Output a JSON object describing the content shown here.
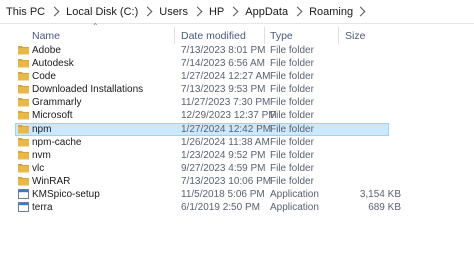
{
  "breadcrumb": {
    "items": [
      "This PC",
      "Local Disk (C:)",
      "Users",
      "HP",
      "AppData",
      "Roaming"
    ]
  },
  "columns": {
    "name": "Name",
    "date_modified": "Date modified",
    "type": "Type",
    "size": "Size"
  },
  "colors": {
    "folder": "#e8b84a",
    "folder_tab": "#d9a43a",
    "selection": "#cce8ff",
    "selection_border": "#99d1ff"
  },
  "files": [
    {
      "name": "Adobe",
      "date": "7/13/2023 8:01 PM",
      "type": "File folder",
      "size": "",
      "icon": "folder-icon"
    },
    {
      "name": "Autodesk",
      "date": "7/14/2023 6:56 AM",
      "type": "File folder",
      "size": "",
      "icon": "folder-icon"
    },
    {
      "name": "Code",
      "date": "1/27/2024 12:27 AM",
      "type": "File folder",
      "size": "",
      "icon": "folder-icon"
    },
    {
      "name": "Downloaded Installations",
      "date": "7/13/2023 9:53 PM",
      "type": "File folder",
      "size": "",
      "icon": "folder-icon"
    },
    {
      "name": "Grammarly",
      "date": "11/27/2023 7:30 PM",
      "type": "File folder",
      "size": "",
      "icon": "folder-icon"
    },
    {
      "name": "Microsoft",
      "date": "12/29/2023 12:37 PM",
      "type": "File folder",
      "size": "",
      "icon": "folder-icon"
    },
    {
      "name": "npm",
      "date": "1/27/2024 12:42 PM",
      "type": "File folder",
      "size": "",
      "icon": "folder-icon",
      "selected": true
    },
    {
      "name": "npm-cache",
      "date": "1/26/2024 11:38 AM",
      "type": "File folder",
      "size": "",
      "icon": "folder-icon"
    },
    {
      "name": "nvm",
      "date": "1/23/2024 9:52 PM",
      "type": "File folder",
      "size": "",
      "icon": "folder-icon"
    },
    {
      "name": "vlc",
      "date": "9/27/2023 4:59 PM",
      "type": "File folder",
      "size": "",
      "icon": "folder-icon"
    },
    {
      "name": "WinRAR",
      "date": "7/13/2023 10:06 PM",
      "type": "File folder",
      "size": "",
      "icon": "folder-icon"
    },
    {
      "name": "KMSpico-setup",
      "date": "11/5/2018 5:06 PM",
      "type": "Application",
      "size": "3,154 KB",
      "icon": "application-icon"
    },
    {
      "name": "terra",
      "date": "6/1/2019 2:50 PM",
      "type": "Application",
      "size": "689 KB",
      "icon": "application-icon"
    }
  ]
}
